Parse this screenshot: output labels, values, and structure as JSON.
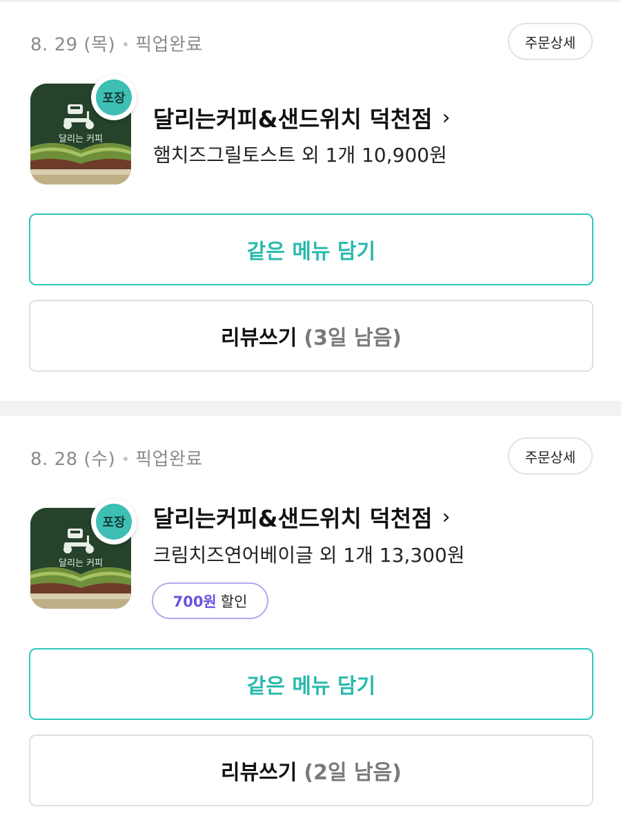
{
  "orders": [
    {
      "date": "8. 29 (목)",
      "status": "픽업완료",
      "detail_label": "주문상세",
      "badge_label": "포장",
      "store_name": "달리는커피&샌드위치 덕천점",
      "chevron": "›",
      "summary": "햄치즈그릴토스트 외 1개 10,900원",
      "reorder_label": "같은 메뉴 담기",
      "review_label": "리뷰쓰기",
      "review_remaining": "(3일 남음)",
      "thumb_text": "달리는 커피"
    },
    {
      "date": "8. 28 (수)",
      "status": "픽업완료",
      "detail_label": "주문상세",
      "badge_label": "포장",
      "store_name": "달리는커피&샌드위치 덕천점",
      "chevron": "›",
      "summary": "크림치즈연어베이글 외 1개 13,300원",
      "discount_amount": "700원",
      "discount_label": "할인",
      "reorder_label": "같은 메뉴 담기",
      "review_label": "리뷰쓰기",
      "review_remaining": "(2일 남음)",
      "thumb_text": "달리는 커피"
    }
  ],
  "colors": {
    "accent_teal": "#2cc7bc",
    "discount_purple": "#6b4fe0",
    "thumb_green": "#25422b"
  },
  "icons": [
    "scooter-logo-icon",
    "chevron-right-icon"
  ]
}
